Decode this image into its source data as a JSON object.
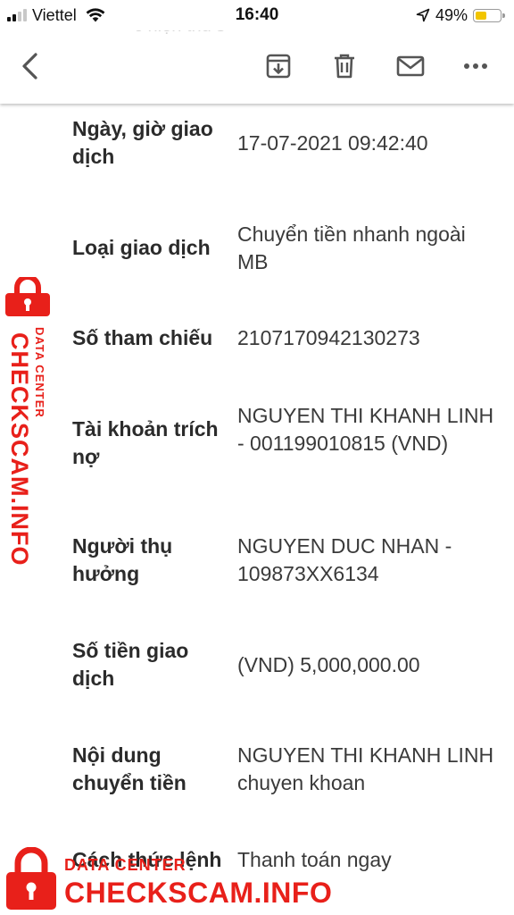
{
  "status_bar": {
    "carrier": "Viettel",
    "time": "16:40",
    "battery_percent": "49%",
    "battery_level": 0.49,
    "signal_bars": 4,
    "signal_active": 2
  },
  "toolbar": {
    "back_icon": "chevron-left-icon",
    "archive_icon": "archive-icon",
    "delete_icon": "trash-icon",
    "mail_icon": "mail-icon",
    "more_icon": "more-horizontal-icon",
    "ghost_title": "c hiện thủ s"
  },
  "details": [
    {
      "label": "Ngày, giờ giao dịch",
      "value": "17-07-2021 09:42:40"
    },
    {
      "label": "Loại giao dịch",
      "value": "Chuyển tiền nhanh ngoài MB"
    },
    {
      "label": "Số tham chiếu",
      "value": "2107170942130273"
    },
    {
      "label": "Tài khoản trích nợ",
      "value": "NGUYEN THI KHANH LINH - 001199010815 (VND)"
    },
    {
      "label": "Người thụ hưởng",
      "value": "NGUYEN DUC NHAN - 109873XX6134"
    },
    {
      "label": "Số tiền giao dịch",
      "value": "(VND) 5,000,000.00"
    },
    {
      "label": "Nội dung chuyển tiền",
      "value": "NGUYEN THI KHANH LINH chuyen khoan"
    },
    {
      "label": "Cách thức lệnh",
      "value": "Thanh toán ngay"
    }
  ],
  "watermark": {
    "brand": "CHECKSCAM.INFO",
    "tagline": "DATA CENTER",
    "color": "#e8201a"
  }
}
